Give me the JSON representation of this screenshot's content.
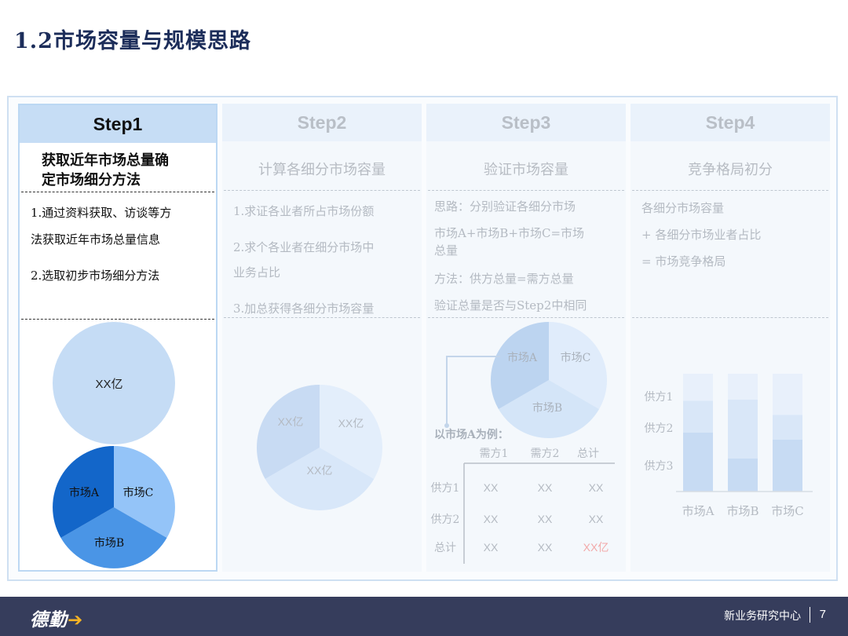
{
  "title": "1.2市场容量与规模思路",
  "steps": [
    {
      "header": "Step1",
      "subtitle_line1": "获取近年市场总量确",
      "subtitle_line2": "定市场细分方法",
      "items": [
        "1.通过资料获取、访谈等方",
        "法获取近年市场总量信息",
        "2.选取初步市场细分方法"
      ],
      "circle_label": "XX亿",
      "pie_labels": [
        "市场A",
        "市场C",
        "市场B"
      ]
    },
    {
      "header": "Step2",
      "subtitle": "计算各细分市场容量",
      "items": [
        "1.求证各业者所占市场份额",
        "2.求个各业者在细分市场中",
        "业务占比",
        "3.加总获得各细分市场容量"
      ],
      "pie_labels": [
        "XX亿",
        "XX亿",
        "XX亿"
      ]
    },
    {
      "header": "Step3",
      "subtitle": "验证市场容量",
      "items": [
        "思路：分别验证各细分市场",
        "市场A+市场B+市场C=市场",
        "总量",
        "方法：供方总量=需方总量",
        "验证总量是否与Step2中相同"
      ],
      "pie_labels": [
        "市场A",
        "市场C",
        "市场B"
      ],
      "example_label": "以市场A为例：",
      "table": {
        "col_headers": [
          "需方1",
          "需方2",
          "总计"
        ],
        "row_headers": [
          "供方1",
          "供方2",
          "总计"
        ],
        "cells": [
          [
            "XX",
            "XX",
            "XX"
          ],
          [
            "XX",
            "XX",
            "XX"
          ],
          [
            "XX",
            "XX",
            "XX亿"
          ]
        ],
        "highlight_color": "#f2a9a9"
      }
    },
    {
      "header": "Step4",
      "subtitle": "竞争格局初分",
      "items": [
        "各细分市场容量",
        "+ 各细分市场业者占比",
        "= 市场竞争格局"
      ],
      "bar_chart": {
        "row_labels": [
          "供方1",
          "供方2",
          "供方3"
        ],
        "categories": [
          "市场A",
          "市场B",
          "市场C"
        ],
        "segments": [
          [
            0.23,
            0.27,
            0.5
          ],
          [
            0.22,
            0.5,
            0.28
          ],
          [
            0.35,
            0.21,
            0.44
          ]
        ]
      }
    }
  ],
  "footer": {
    "logo_text": "德勤",
    "logo_mark": "➔",
    "department": "新业务研究中心",
    "page_number": "7"
  },
  "colors": {
    "title": "#1c2d5a",
    "footer_bg": "#363d5c",
    "pie_dark": "#1366c9",
    "pie_mid": "#4a95e6",
    "pie_light": "#94c4f8",
    "circle_fill": "#c5dcf5"
  }
}
